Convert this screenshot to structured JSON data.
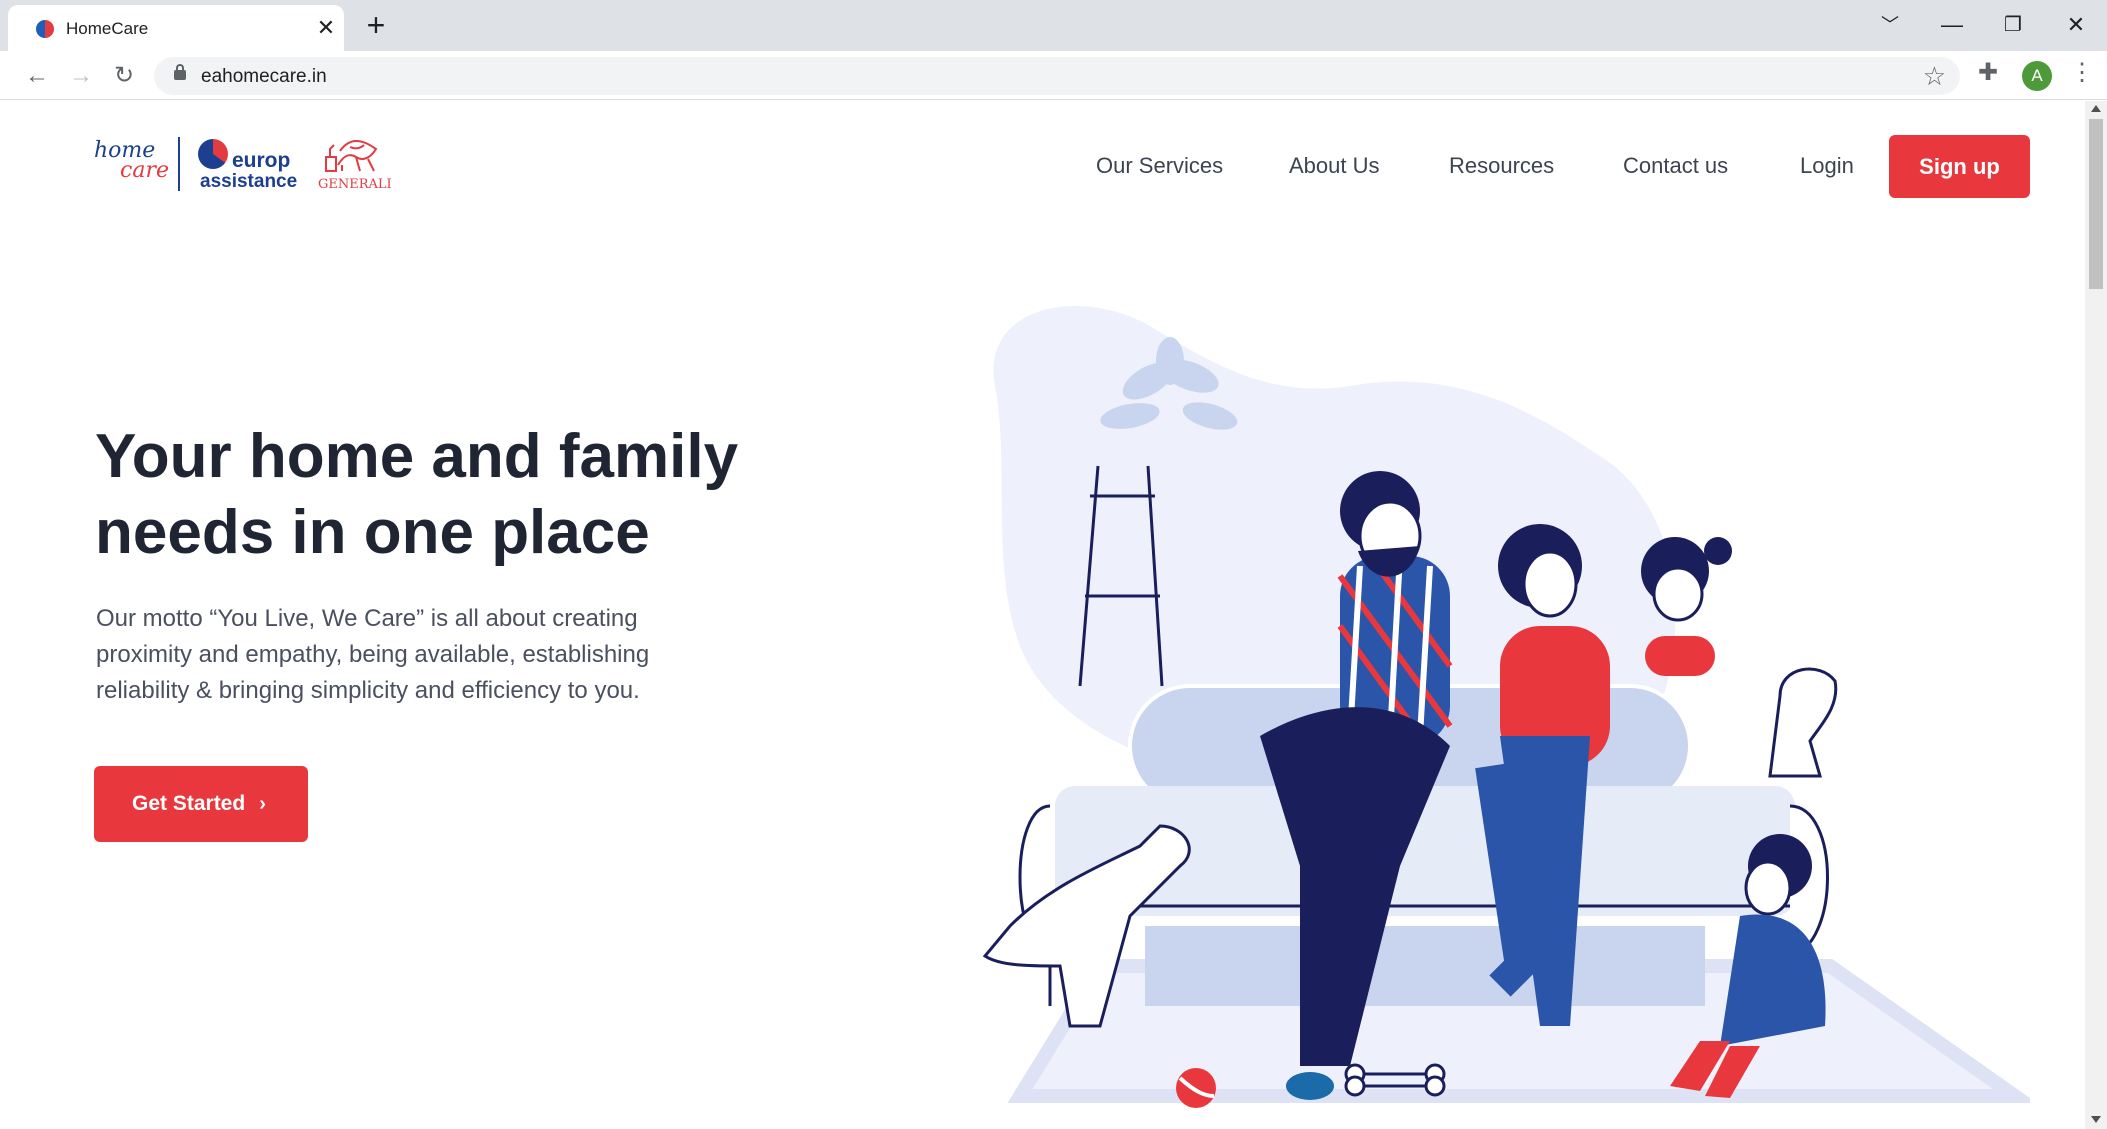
{
  "browser": {
    "tab_title": "HomeCare",
    "tab_close": "✕",
    "new_tab": "+",
    "url": "eahomecare.in",
    "profile_initial": "A",
    "window_controls": [
      "﹀",
      "—",
      "❐",
      "✕"
    ]
  },
  "header": {
    "logo": {
      "home": "home",
      "care": "care",
      "europ": "europ",
      "assistance": "assistance",
      "generali": "GENERALI"
    },
    "nav": [
      "Our Services",
      "About Us",
      "Resources",
      "Contact us",
      "Login"
    ],
    "signup_label": "Sign up"
  },
  "hero": {
    "title": "Your home and family needs in one place",
    "description": "Our motto “You Live, We Care” is all about creating proximity and empathy, being available, establishing reliability & bringing simplicity and efficiency to you.",
    "cta_label": "Get Started",
    "cta_icon": "chevron-right-icon"
  },
  "colors": {
    "brand_red": "#e8383d",
    "brand_blue": "#1d3f8f",
    "heading": "#1f2532"
  }
}
